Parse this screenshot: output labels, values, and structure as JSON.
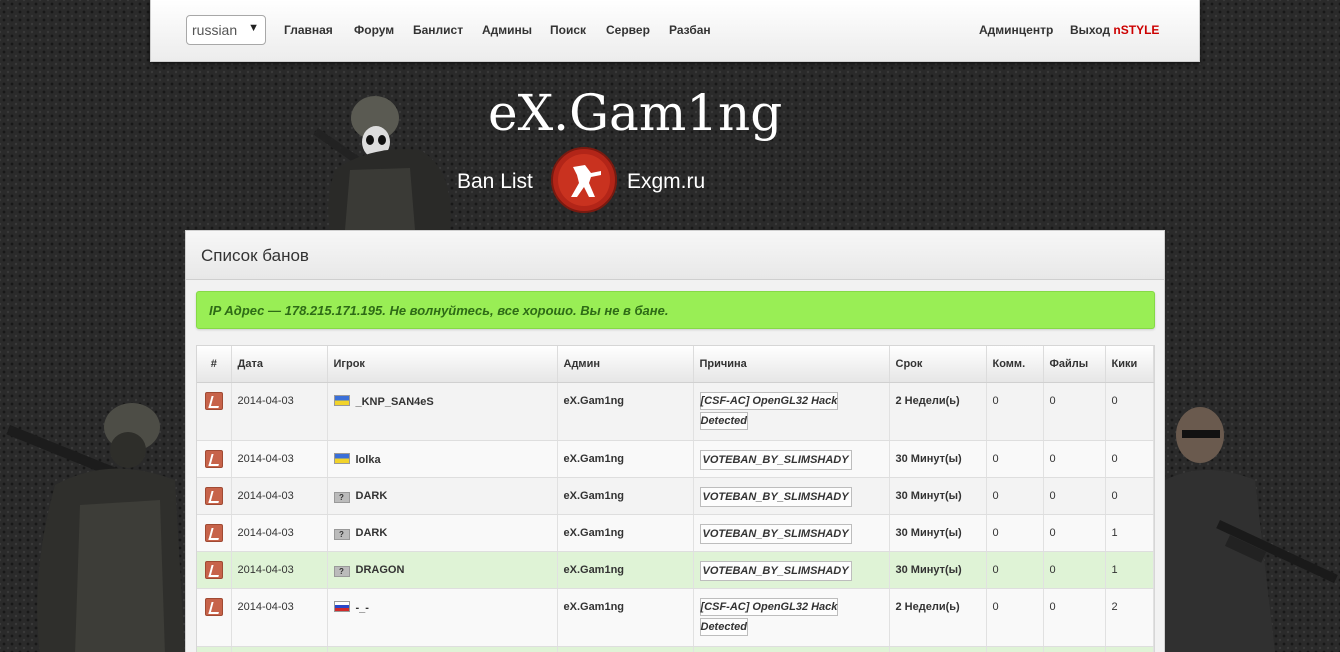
{
  "nav": {
    "language": "russian",
    "links": [
      "Главная",
      "Форум",
      "Банлист",
      "Админы",
      "Поиск",
      "Сервер",
      "Разбан"
    ],
    "admin_center": "Админцентр",
    "logout": "Выход",
    "user": "nSTYLE"
  },
  "header": {
    "title": "eX.Gam1ng",
    "left_text": "Ban List",
    "right_text": "Exgm.ru"
  },
  "panel": {
    "title": "Список банов",
    "alert": "IP Адрес — 178.215.171.195. Не волнуйтесь, все хорошо. Вы не в бане."
  },
  "table": {
    "headers": [
      "#",
      "Дата",
      "Игрок",
      "Админ",
      "Причина",
      "Срок",
      "Комм.",
      "Файлы",
      "Кики"
    ],
    "rows": [
      {
        "date": "2014-04-03",
        "flag": "ua",
        "player": "_KNP_SAN4eS",
        "admin": "eX.Gam1ng",
        "reason": [
          "[CSF-AC] OpenGL32 Hack",
          "Detected"
        ],
        "term": "2 Недели(ь)",
        "comments": "0",
        "files": "0",
        "kicks": "0"
      },
      {
        "date": "2014-04-03",
        "flag": "ua",
        "player": "lolka",
        "admin": "eX.Gam1ng",
        "reason": [
          "VOTEBAN_BY_SLIMSHADY"
        ],
        "term": "30 Минут(ы)",
        "comments": "0",
        "files": "0",
        "kicks": "0"
      },
      {
        "date": "2014-04-03",
        "flag": "unknown",
        "player": "DARK",
        "admin": "eX.Gam1ng",
        "reason": [
          "VOTEBAN_BY_SLIMSHADY"
        ],
        "term": "30 Минут(ы)",
        "comments": "0",
        "files": "0",
        "kicks": "0"
      },
      {
        "date": "2014-04-03",
        "flag": "unknown",
        "player": "DARK",
        "admin": "eX.Gam1ng",
        "reason": [
          "VOTEBAN_BY_SLIMSHADY"
        ],
        "term": "30 Минут(ы)",
        "comments": "0",
        "files": "0",
        "kicks": "1"
      },
      {
        "date": "2014-04-03",
        "flag": "unknown",
        "player": "DRAGON",
        "admin": "eX.Gam1ng",
        "reason": [
          "VOTEBAN_BY_SLIMSHADY"
        ],
        "term": "30 Минут(ы)",
        "comments": "0",
        "files": "0",
        "kicks": "1"
      },
      {
        "date": "2014-04-03",
        "flag": "ru",
        "player": "-_-",
        "admin": "eX.Gam1ng",
        "reason": [
          "[CSF-AC] OpenGL32 Hack",
          "Detected"
        ],
        "term": "2 Недели(ь)",
        "comments": "0",
        "files": "0",
        "kicks": "2"
      }
    ]
  }
}
